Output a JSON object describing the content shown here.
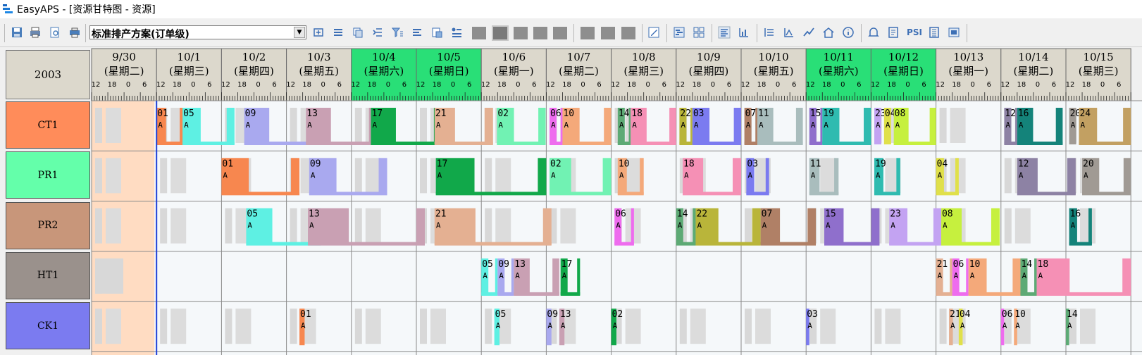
{
  "window": {
    "title": "EasyAPS - [资源甘特图 - 资源]"
  },
  "toolbar": {
    "plan_combo_value": "标准排产方案(订单级)",
    "icons": [
      "save-icon",
      "print-icon",
      "preview-icon",
      "printer-setup-icon",
      "refresh-icon",
      "align-icon",
      "copy-icon",
      "indent-icon",
      "filter-icon",
      "sort-icon",
      "export-icon",
      "legend-icon",
      "zoom-day-icon",
      "zoom-week-icon",
      "zoom-month-icon",
      "zoom-quarter-icon",
      "zoom-year-icon",
      "view1-icon",
      "view2-icon",
      "view3-icon",
      "edit-icon",
      "gantt-view-icon",
      "grid-view-icon",
      "text-view-icon",
      "chart-view-icon",
      "list-view-icon",
      "bar-view-icon",
      "line-view-icon",
      "home-icon",
      "info-icon",
      "bell-icon",
      "note-icon",
      "psi-icon",
      "doc-icon",
      "report-icon"
    ],
    "psi_label": "PSI"
  },
  "gantt": {
    "corner_label": "2003",
    "dates": [
      {
        "date": "9/30",
        "weekday": "(星期二)",
        "weekend": false
      },
      {
        "date": "10/1",
        "weekday": "(星期三)",
        "weekend": false
      },
      {
        "date": "10/2",
        "weekday": "(星期四)",
        "weekend": false
      },
      {
        "date": "10/3",
        "weekday": "(星期五)",
        "weekend": false
      },
      {
        "date": "10/4",
        "weekday": "(星期六)",
        "weekend": true
      },
      {
        "date": "10/5",
        "weekday": "(星期日)",
        "weekend": true
      },
      {
        "date": "10/6",
        "weekday": "(星期一)",
        "weekend": false
      },
      {
        "date": "10/7",
        "weekday": "(星期二)",
        "weekend": false
      },
      {
        "date": "10/8",
        "weekday": "(星期三)",
        "weekend": false
      },
      {
        "date": "10/9",
        "weekday": "(星期四)",
        "weekend": false
      },
      {
        "date": "10/10",
        "weekday": "(星期五)",
        "weekend": false
      },
      {
        "date": "10/11",
        "weekday": "(星期六)",
        "weekend": true
      },
      {
        "date": "10/12",
        "weekday": "(星期日)",
        "weekend": true
      },
      {
        "date": "10/13",
        "weekday": "(星期一)",
        "weekend": false
      },
      {
        "date": "10/14",
        "weekday": "(星期二)",
        "weekend": false
      },
      {
        "date": "10/15",
        "weekday": "(星期三)",
        "weekend": false
      }
    ],
    "hour_ticks": [
      "12",
      "18",
      "0",
      "6"
    ],
    "resources": [
      {
        "name": "CT1",
        "color": "#ff8c5a"
      },
      {
        "name": "PR1",
        "color": "#64ffaa"
      },
      {
        "name": "PR2",
        "color": "#c8967a"
      },
      {
        "name": "HT1",
        "color": "#9a918c"
      },
      {
        "name": "CK1",
        "color": "#7b7bf0"
      }
    ],
    "tasks": [
      {
        "row": 0,
        "label": "01",
        "sub": "A",
        "start": 1.0,
        "len": 0.42,
        "color": "#f7874f"
      },
      {
        "row": 0,
        "label": "05",
        "sub": "A",
        "start": 1.4,
        "len": 0.8,
        "color": "#5ef0e3"
      },
      {
        "row": 0,
        "label": "09",
        "sub": "A",
        "start": 2.35,
        "len": 1.1,
        "color": "#a9a9ef"
      },
      {
        "row": 0,
        "label": "13",
        "sub": "A",
        "start": 3.3,
        "len": 1.1,
        "color": "#c9a0b3"
      },
      {
        "row": 0,
        "label": "17",
        "sub": "A",
        "start": 4.3,
        "len": 1.1,
        "color": "#11a84a"
      },
      {
        "row": 0,
        "label": "21",
        "sub": "A",
        "start": 5.28,
        "len": 0.9,
        "color": "#e4b092"
      },
      {
        "row": 0,
        "label": "02",
        "sub": "A",
        "start": 6.24,
        "len": 0.75,
        "color": "#71f2b3"
      },
      {
        "row": 0,
        "label": "06",
        "sub": "A",
        "start": 7.05,
        "len": 0.2,
        "color": "#ee6cee"
      },
      {
        "row": 0,
        "label": "10",
        "sub": "A",
        "start": 7.25,
        "len": 0.75,
        "color": "#f4a97a"
      },
      {
        "row": 0,
        "label": "14",
        "sub": "A",
        "start": 8.1,
        "len": 0.2,
        "color": "#5daa75"
      },
      {
        "row": 0,
        "label": "18",
        "sub": "A",
        "start": 8.3,
        "len": 0.7,
        "color": "#f590b5"
      },
      {
        "row": 0,
        "label": "22",
        "sub": "A",
        "start": 9.05,
        "len": 0.2,
        "color": "#b9b53a"
      },
      {
        "row": 0,
        "label": "03",
        "sub": "A",
        "start": 9.25,
        "len": 0.75,
        "color": "#7b7bf0"
      },
      {
        "row": 0,
        "label": "07",
        "sub": "A",
        "start": 10.05,
        "len": 0.2,
        "color": "#b08066"
      },
      {
        "row": 0,
        "label": "11",
        "sub": "A",
        "start": 10.25,
        "len": 0.7,
        "color": "#a9bdbd"
      },
      {
        "row": 0,
        "label": "15",
        "sub": "A",
        "start": 11.05,
        "len": 0.2,
        "color": "#8f6fcc"
      },
      {
        "row": 0,
        "label": "19",
        "sub": "A",
        "start": 11.25,
        "len": 0.75,
        "color": "#2fbbb0"
      },
      {
        "row": 0,
        "label": "23",
        "sub": "A",
        "start": 12.05,
        "len": 0.15,
        "color": "#c3a3f2"
      },
      {
        "row": 0,
        "label": "04",
        "sub": "A",
        "start": 12.2,
        "len": 0.15,
        "color": "#e0e04a"
      },
      {
        "row": 0,
        "label": "08",
        "sub": "A",
        "start": 12.35,
        "len": 0.65,
        "color": "#c6f03e"
      },
      {
        "row": 0,
        "label": "12",
        "sub": "A",
        "start": 14.05,
        "len": 0.2,
        "color": "#8d82a4"
      },
      {
        "row": 0,
        "label": "16",
        "sub": "A",
        "start": 14.25,
        "len": 0.7,
        "color": "#14837a"
      },
      {
        "row": 0,
        "label": "20",
        "sub": "A",
        "start": 15.05,
        "len": 0.15,
        "color": "#a09a94"
      },
      {
        "row": 0,
        "label": "24",
        "sub": "A",
        "start": 15.2,
        "len": 0.8,
        "color": "#c2a062"
      },
      {
        "row": 1,
        "label": "01",
        "sub": "A",
        "start": 2.0,
        "len": 1.2,
        "color": "#f7874f"
      },
      {
        "row": 1,
        "label": "09",
        "sub": "A",
        "start": 3.35,
        "len": 1.2,
        "color": "#a9a9ef"
      },
      {
        "row": 1,
        "label": "17",
        "sub": "A",
        "start": 5.3,
        "len": 1.7,
        "color": "#11a84a"
      },
      {
        "row": 1,
        "label": "02",
        "sub": "A",
        "start": 7.05,
        "len": 0.95,
        "color": "#71f2b3"
      },
      {
        "row": 1,
        "label": "10",
        "sub": "A",
        "start": 8.1,
        "len": 0.4,
        "color": "#f4a97a"
      },
      {
        "row": 1,
        "label": "18",
        "sub": "A",
        "start": 9.1,
        "len": 0.9,
        "color": "#f590b5"
      },
      {
        "row": 1,
        "label": "03",
        "sub": "A",
        "start": 10.08,
        "len": 0.35,
        "color": "#7b7bf0"
      },
      {
        "row": 1,
        "label": "11",
        "sub": "A",
        "start": 11.05,
        "len": 0.45,
        "color": "#a9bdbd"
      },
      {
        "row": 1,
        "label": "19",
        "sub": "A",
        "start": 12.05,
        "len": 0.4,
        "color": "#2fbbb0"
      },
      {
        "row": 1,
        "label": "04",
        "sub": "A",
        "start": 13.0,
        "len": 0.35,
        "color": "#e0e04a"
      },
      {
        "row": 1,
        "label": "12",
        "sub": "A",
        "start": 14.25,
        "len": 0.9,
        "color": "#8d82a4"
      },
      {
        "row": 1,
        "label": "20",
        "sub": "A",
        "start": 15.25,
        "len": 0.75,
        "color": "#a09a94"
      },
      {
        "row": 2,
        "label": "05",
        "sub": "A",
        "start": 2.38,
        "len": 1.15,
        "color": "#5ef0e3"
      },
      {
        "row": 2,
        "label": "13",
        "sub": "A",
        "start": 3.33,
        "len": 1.8,
        "color": "#c9a0b3"
      },
      {
        "row": 2,
        "label": "21",
        "sub": "A",
        "start": 5.28,
        "len": 1.8,
        "color": "#e4b092"
      },
      {
        "row": 2,
        "label": "06",
        "sub": "A",
        "start": 8.05,
        "len": 0.3,
        "color": "#ee6cee"
      },
      {
        "row": 2,
        "label": "14",
        "sub": "A",
        "start": 9.0,
        "len": 0.3,
        "color": "#5daa75"
      },
      {
        "row": 2,
        "label": "22",
        "sub": "A",
        "start": 9.3,
        "len": 1.0,
        "color": "#b9b53a"
      },
      {
        "row": 2,
        "label": "07",
        "sub": "A",
        "start": 10.3,
        "len": 0.85,
        "color": "#b08066"
      },
      {
        "row": 2,
        "label": "15",
        "sub": "A",
        "start": 11.28,
        "len": 0.85,
        "color": "#8f6fcc"
      },
      {
        "row": 2,
        "label": "23",
        "sub": "A",
        "start": 12.28,
        "len": 0.8,
        "color": "#c3a3f2"
      },
      {
        "row": 2,
        "label": "08",
        "sub": "A",
        "start": 13.08,
        "len": 0.9,
        "color": "#c6f03e"
      },
      {
        "row": 2,
        "label": "16",
        "sub": "A",
        "start": 15.05,
        "len": 0.35,
        "color": "#14837a"
      },
      {
        "row": 3,
        "label": "05",
        "sub": "A",
        "start": 6.0,
        "len": 0.25,
        "color": "#5ef0e3"
      },
      {
        "row": 3,
        "label": "09",
        "sub": "A",
        "start": 6.25,
        "len": 0.25,
        "color": "#a9a9ef"
      },
      {
        "row": 3,
        "label": "13",
        "sub": "A",
        "start": 6.5,
        "len": 0.7,
        "color": "#c9a0b3"
      },
      {
        "row": 3,
        "label": "17",
        "sub": "A",
        "start": 7.22,
        "len": 0.3,
        "color": "#11a84a"
      },
      {
        "row": 3,
        "label": "21",
        "sub": "A",
        "start": 13.0,
        "len": 0.25,
        "color": "#e4b092"
      },
      {
        "row": 3,
        "label": "06",
        "sub": "A",
        "start": 13.25,
        "len": 0.25,
        "color": "#ee6cee"
      },
      {
        "row": 3,
        "label": "10",
        "sub": "A",
        "start": 13.5,
        "len": 0.8,
        "color": "#f4a97a"
      },
      {
        "row": 3,
        "label": "14",
        "sub": "A",
        "start": 14.3,
        "len": 0.25,
        "color": "#5daa75"
      },
      {
        "row": 3,
        "label": "18",
        "sub": "A",
        "start": 14.55,
        "len": 1.45,
        "color": "#f590b5"
      },
      {
        "row": 4,
        "label": "01",
        "sub": "A",
        "start": 3.2,
        "len": 0.08,
        "color": "#f7874f"
      },
      {
        "row": 4,
        "label": "05",
        "sub": "A",
        "start": 6.2,
        "len": 0.08,
        "color": "#5ef0e3"
      },
      {
        "row": 4,
        "label": "09",
        "sub": "A",
        "start": 7.0,
        "len": 0.08,
        "color": "#a9a9ef"
      },
      {
        "row": 4,
        "label": "13",
        "sub": "A",
        "start": 7.2,
        "len": 0.08,
        "color": "#c9a0b3"
      },
      {
        "row": 4,
        "label": "02",
        "sub": "A",
        "start": 8.0,
        "len": 0.08,
        "color": "#11a84a"
      },
      {
        "row": 4,
        "label": "03",
        "sub": "A",
        "start": 11.0,
        "len": 0.05,
        "color": "#7b7bf0"
      },
      {
        "row": 4,
        "label": "21",
        "sub": "A",
        "start": 13.2,
        "len": 0.06,
        "color": "#e4b092"
      },
      {
        "row": 4,
        "label": "04",
        "sub": "A",
        "start": 13.35,
        "len": 0.06,
        "color": "#e0e04a"
      },
      {
        "row": 4,
        "label": "06",
        "sub": "A",
        "start": 14.0,
        "len": 0.05,
        "color": "#ee6cee"
      },
      {
        "row": 4,
        "label": "10",
        "sub": "A",
        "start": 14.2,
        "len": 0.05,
        "color": "#f4a97a"
      },
      {
        "row": 4,
        "label": "14",
        "sub": "A",
        "start": 15.0,
        "len": 0.05,
        "color": "#5daa75"
      }
    ]
  }
}
